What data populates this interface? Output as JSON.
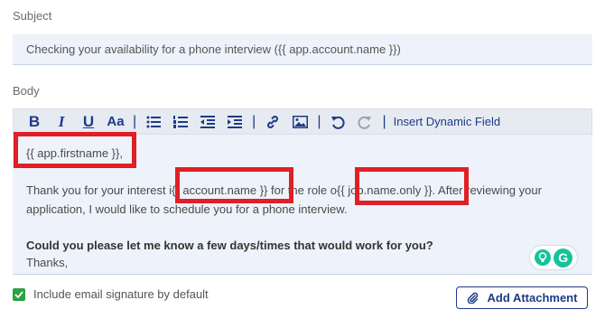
{
  "subject": {
    "label": "Subject",
    "value": "Checking your availability for a phone interview ({{ app.account.name }})"
  },
  "body": {
    "label": "Body",
    "toolbar": {
      "bold": "B",
      "italic": "I",
      "underline": "U",
      "font_size": "Aa",
      "separator": "|",
      "insert_dynamic_field": "Insert Dynamic Field"
    },
    "content": {
      "greeting": "{{ app.firstname }},",
      "p1_a": "Thank you for your interest i",
      "p1_account_token": "{{ account.name }}",
      "p1_b": " for the role o",
      "p1_job_token": "{{ job.name.only }}",
      "p1_c": ". After reviewing your",
      "p1_line2": "application, I would like to schedule you for a phone interview.",
      "question": "Could you please let me know a few days/times that would work for you?",
      "thanks": "Thanks,"
    }
  },
  "signature_checkbox": {
    "label": "Include email signature by default",
    "checked": true
  },
  "attach_button": {
    "label": "Add Attachment"
  },
  "colors": {
    "accent": "#1e3a8a",
    "highlight": "#e01f26",
    "check": "#2ea043",
    "grammarly": "#15c39a",
    "field_bg": "#eef3fb"
  }
}
